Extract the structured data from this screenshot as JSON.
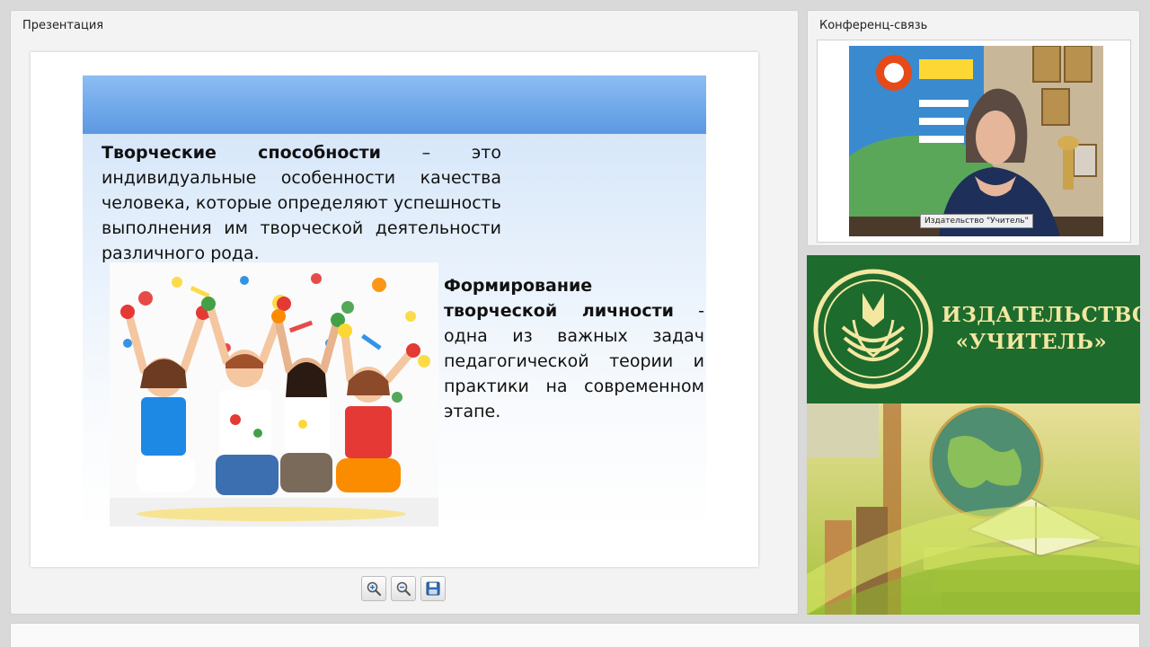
{
  "presentation": {
    "title": "Презентация",
    "slide": {
      "definition": {
        "term": "Творческие способности",
        "dash": " – ",
        "rest": "это индивидуальные особенности качества человека, которые определяют успешность выполнения им творческой деятельности различного рода."
      },
      "formation": {
        "term": "Формирование творческой личности",
        "rest": " - одна из важных задач педагогической теории и практики на современном этапе."
      }
    },
    "toolbar": {
      "zoom_in": "zoom-in-icon",
      "zoom_out": "zoom-out-icon",
      "save": "save-icon"
    }
  },
  "conference": {
    "title": "Конференц-связь",
    "speaker_label": "Издательство \"Учитель\""
  },
  "brand": {
    "line1": "ИЗДАТЕЛЬСТВО",
    "line2": "«УЧИТЕЛЬ»"
  },
  "colors": {
    "slide_header": "#6ea7ea",
    "brand_green": "#1d6b2d",
    "brand_gold": "#f4e7a1"
  }
}
